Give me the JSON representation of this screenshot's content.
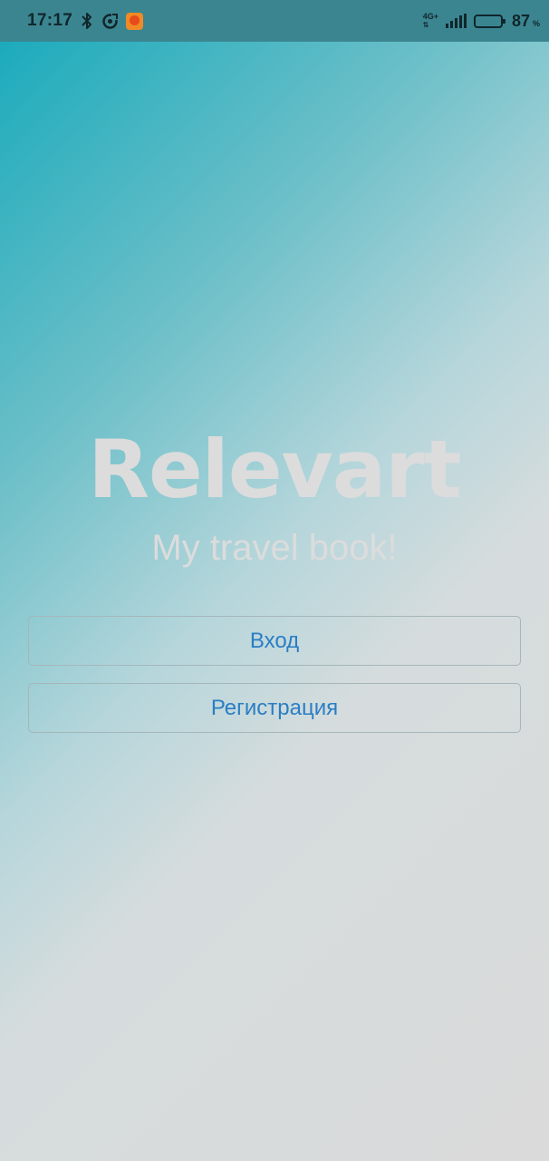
{
  "status_bar": {
    "time": "17:17",
    "network_type": "4G+",
    "battery_percent": "87",
    "battery_unit": "%",
    "battery_level": 0.87,
    "icons": [
      "bluetooth-icon",
      "sync-icon",
      "app-notification-icon",
      "signal-icon",
      "battery-icon"
    ]
  },
  "app": {
    "title": "Relevart",
    "subtitle": "My travel book!"
  },
  "buttons": {
    "login_label": "Вход",
    "register_label": "Регистрация"
  },
  "colors": {
    "gradient_start": "#14a9bb",
    "gradient_end": "#dadada",
    "button_text": "#2a7ec4",
    "title_text": "#dcdcdc"
  }
}
